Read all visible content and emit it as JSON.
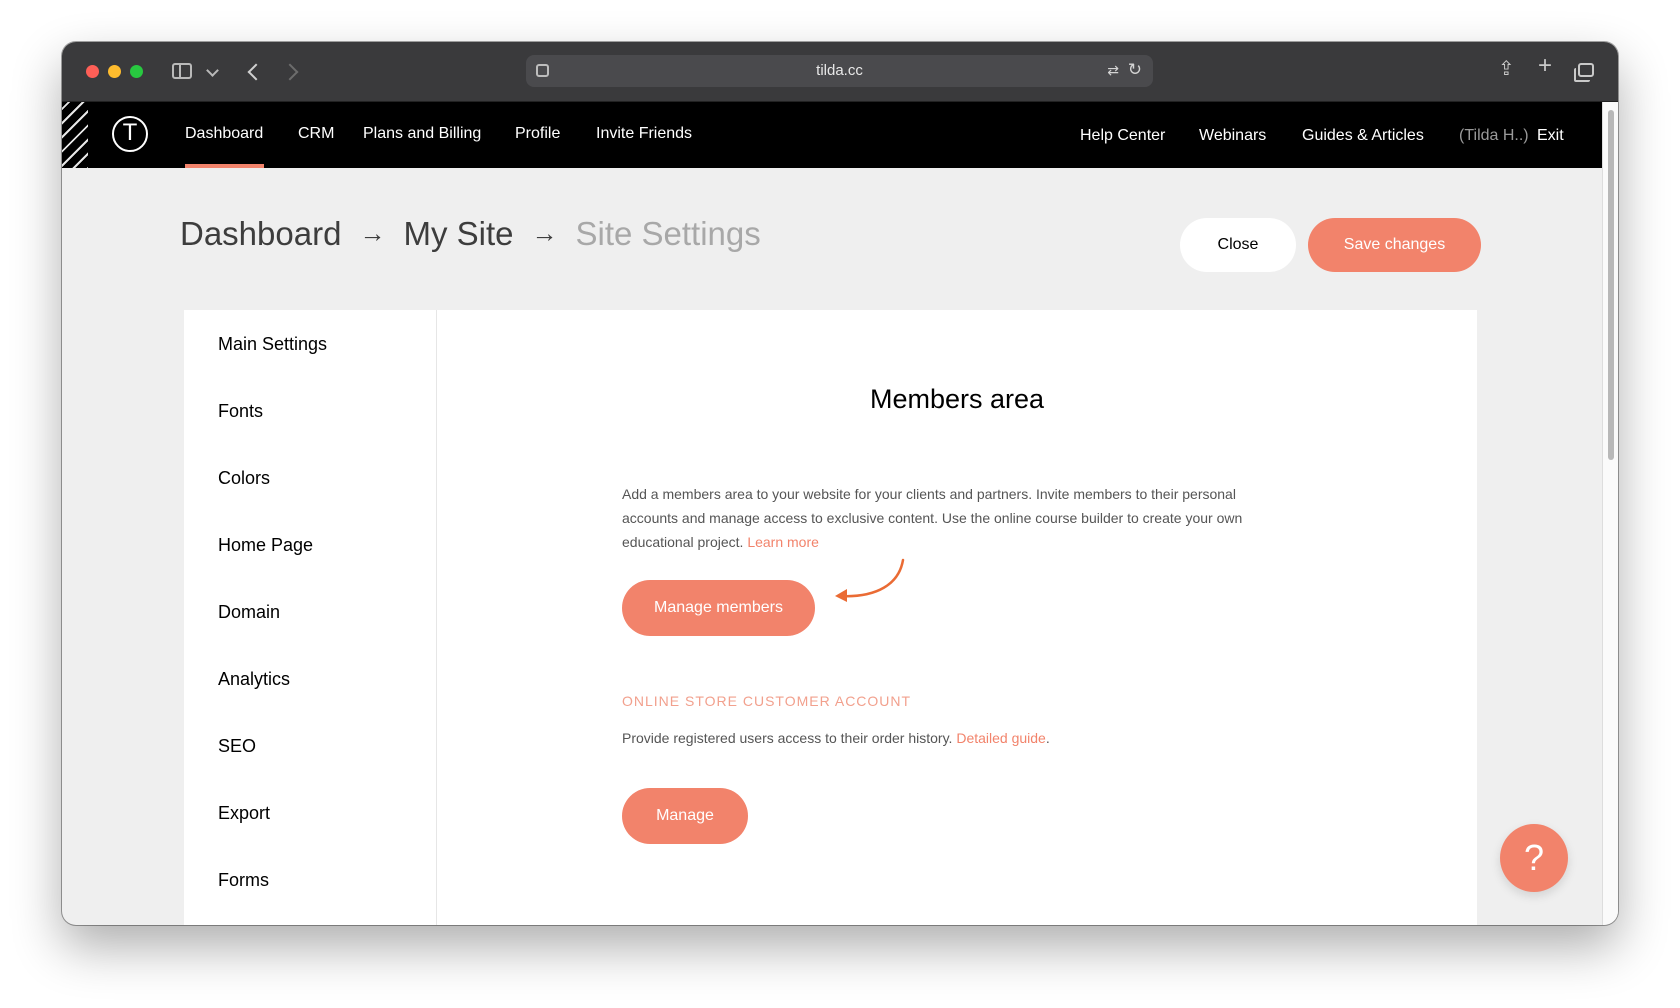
{
  "browser": {
    "url": "tilda.cc"
  },
  "nav": {
    "left": [
      "Dashboard",
      "CRM",
      "Plans and Billing",
      "Profile",
      "Invite Friends"
    ],
    "right": [
      "Help Center",
      "Webinars",
      "Guides & Articles"
    ],
    "user": "(Tilda H..)",
    "exit": "Exit"
  },
  "breadcrumb": {
    "items": [
      "Dashboard",
      "My Site",
      "Site Settings"
    ],
    "separator": "→"
  },
  "buttons": {
    "close": "Close",
    "save": "Save changes"
  },
  "sidebar": {
    "items": [
      "Main Settings",
      "Fonts",
      "Colors",
      "Home Page",
      "Domain",
      "Analytics",
      "SEO",
      "Export",
      "Forms"
    ]
  },
  "members": {
    "title": "Members area",
    "description": "Add a members area to your website for your clients and partners. Invite members to their personal accounts and manage access to exclusive content. Use the online course builder to create your own educational project.",
    "learn_more": "Learn more",
    "manage_members": "Manage members"
  },
  "store": {
    "heading": "ONLINE STORE CUSTOMER ACCOUNT",
    "description": "Provide registered users access to their order history.",
    "guide_link": "Detailed guide",
    "period": ".",
    "manage": "Manage"
  },
  "help": {
    "symbol": "?"
  },
  "colors": {
    "accent": "#f2836b",
    "nav_bg": "#000000",
    "page_bg": "#efefef"
  }
}
